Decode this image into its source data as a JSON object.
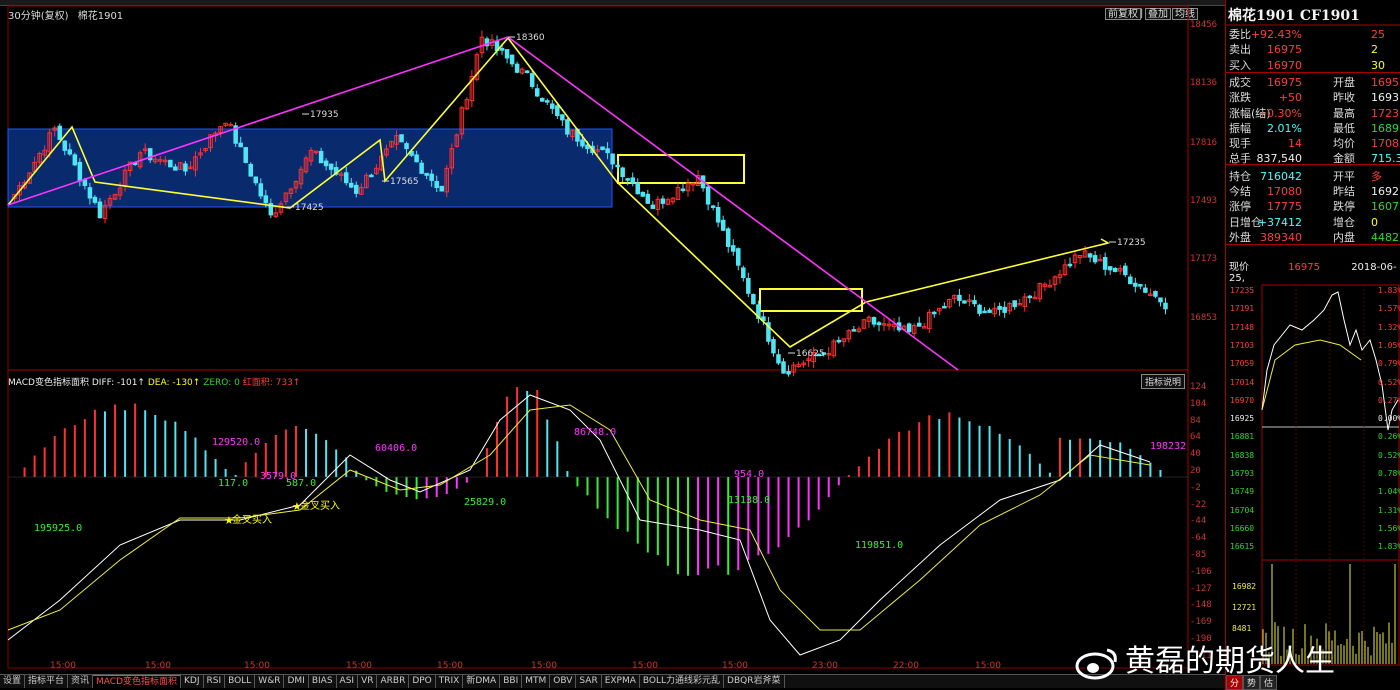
{
  "chart_title": {
    "period": "30分钟(复权)",
    "symbol": "棉花1901"
  },
  "toolbar": {
    "left": "前复权",
    "sep": "|",
    "stack": "叠加",
    "more": "均线"
  },
  "main_axis": [
    "18456",
    "18136",
    "17816",
    "17493",
    "17173",
    "16853"
  ],
  "price_labels": [
    "18360",
    "17935",
    "17565",
    "17425",
    "17235",
    "16625"
  ],
  "kline": {
    "points": [
      17540,
      17880,
      17440,
      17760,
      17665,
      17935,
      17425,
      17760,
      17560,
      17820,
      17565,
      18360,
      18150,
      17870,
      17720,
      17480,
      17640,
      17160,
      16625,
      16720,
      16880,
      16820,
      17000,
      16920,
      17050,
      17235,
      17120,
      16975
    ],
    "colors": {
      "up": "#ff3030",
      "down": "#4ee5f5",
      "wave": "#ffff33",
      "trend": "#ff33ff",
      "box_fill": "#0a2a6e",
      "box_edge": "#2255ff"
    }
  },
  "indicator": {
    "name": "MACD变色指标面积",
    "diff": "DIFF: -101↑",
    "dea": "DEA: -130↑",
    "zero": "ZERO: 0",
    "area": "红面积: 733↑",
    "help_btn": "指标说明",
    "axis": [
      "124",
      "104",
      "84",
      "64",
      "40",
      "20",
      "-2",
      "-22",
      "-44",
      "-64",
      "-85",
      "-106",
      "-127",
      "-148",
      "-169",
      "-190",
      "-211"
    ],
    "area_labels": [
      "129520.0",
      "60406.0",
      "86748.0",
      "198232",
      "117.0",
      "3579.0",
      "587.0",
      "954.0",
      "195925.0",
      "25829.0",
      "13138.0",
      "119851.0"
    ],
    "signals": [
      "金叉买入",
      "金叉买入"
    ]
  },
  "time_labels": [
    "15:00",
    "15:00",
    "15:00",
    "15:00",
    "15:00",
    "15:00",
    "15:00",
    "15:00",
    "23:00",
    "22:00",
    "15:00"
  ],
  "bottom_tabs": [
    "设置",
    "指标平台",
    "资讯",
    "MACD变色指标面积",
    "KDJ",
    "RSI",
    "BOLL",
    "W&R",
    "DMI",
    "BIAS",
    "ASI",
    "VR",
    "ARBR",
    "DPO",
    "TRIX",
    "新DMA",
    "BBI",
    "MTM",
    "OBV",
    "SAR",
    "EXPMA",
    "BOLL力通线彩元乱",
    "DBQR岩斧菜"
  ],
  "quote": {
    "title": "棉花1901 CF1901",
    "rows": [
      {
        "l1": "委比",
        "v1": "+92.43%",
        "c1": "red",
        "l2": "",
        "v2": "25",
        "c2": "red"
      },
      {
        "l1": "卖出",
        "v1": "16975",
        "c1": "red",
        "l2": "",
        "v2": "2",
        "c2": "yel"
      },
      {
        "l1": "买入",
        "v1": "16970",
        "c1": "red",
        "l2": "",
        "v2": "30",
        "c2": "yel"
      },
      {
        "l1": "成交",
        "v1": "16975",
        "c1": "red",
        "l2": "开盘",
        "v2": "1695",
        "c2": "red"
      },
      {
        "l1": "涨跌",
        "v1": "+50",
        "c1": "red",
        "l2": "昨收",
        "v2": "1693",
        "c2": "white"
      },
      {
        "l1": "涨幅(结)",
        "v1": "+0.30%",
        "c1": "red",
        "l2": "最高",
        "v2": "1723",
        "c2": "red"
      },
      {
        "l1": "振幅",
        "v1": "2.01%",
        "c1": "cyan",
        "l2": "最低",
        "v2": "1689",
        "c2": "green"
      },
      {
        "l1": "现手",
        "v1": "14",
        "c1": "red",
        "l2": "均价",
        "v2": "1708",
        "c2": "red"
      },
      {
        "l1": "总手",
        "v1": "837,540",
        "c1": "white",
        "l2": "金额",
        "v2": "715.3",
        "c2": "cyan"
      },
      {
        "l1": "持仓",
        "v1": "716042",
        "c1": "cyan",
        "l2": "开平",
        "v2": "多",
        "c2": "red"
      },
      {
        "l1": "今结",
        "v1": "17080",
        "c1": "red",
        "l2": "昨结",
        "v2": "1692",
        "c2": "white"
      },
      {
        "l1": "涨停",
        "v1": "17775",
        "c1": "red",
        "l2": "跌停",
        "v2": "1607",
        "c2": "green"
      },
      {
        "l1": "日增仓",
        "v1": "+37412",
        "c1": "cyan",
        "l2": "增仓",
        "v2": "0",
        "c2": "yel"
      },
      {
        "l1": "外盘",
        "v1": "389340",
        "c1": "red",
        "l2": "内盘",
        "v2": "4482",
        "c2": "green"
      }
    ],
    "now_label": "现价",
    "now_price": "16975",
    "now_date": "2018-06-25,"
  },
  "mini_axis_left": [
    "17235",
    "17191",
    "17148",
    "17103",
    "17059",
    "17014",
    "16970",
    "16925",
    "16881",
    "16838",
    "16793",
    "16749",
    "16704",
    "16660",
    "16615"
  ],
  "mini_axis_right": [
    "1.83%",
    "1.57%",
    "1.32%",
    "1.05%",
    "0.79%",
    "0.52%",
    "0.27%",
    "0.00%",
    "0.26%",
    "0.52%",
    "0.78%",
    "1.04%",
    "1.31%",
    "1.56%",
    "1.83%"
  ],
  "mini_vol_axis": [
    "16982",
    "12721",
    "8481"
  ],
  "rp_tabs": [
    "分",
    "势",
    "估"
  ],
  "watermark": "黄磊的期货人生"
}
